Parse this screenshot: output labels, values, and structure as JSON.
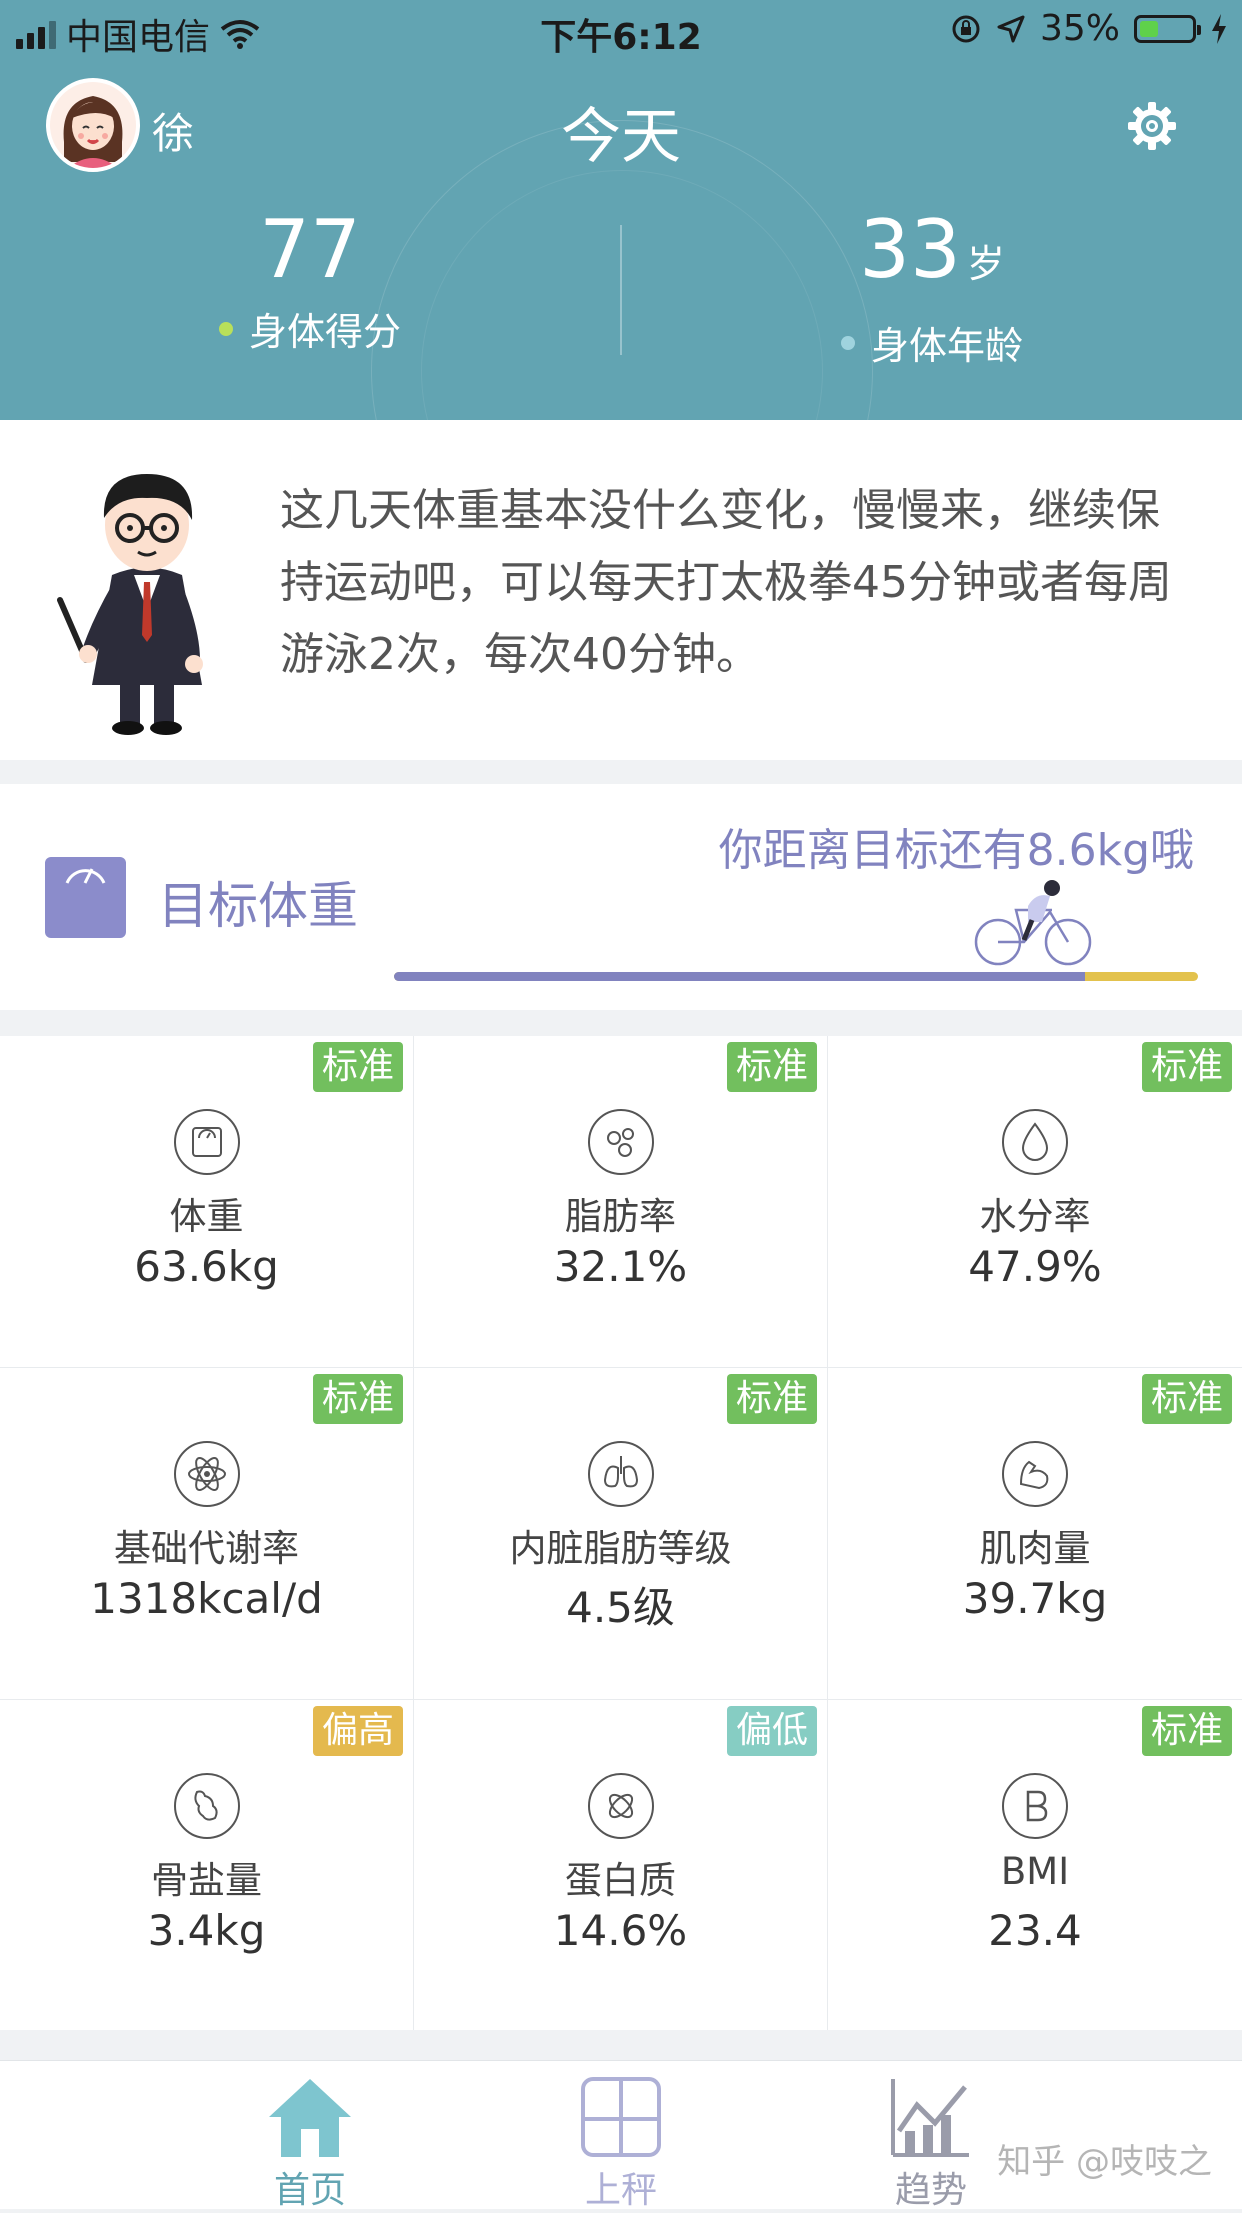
{
  "status_bar": {
    "carrier": "中国电信",
    "time": "下午6:12",
    "battery_percent": "35%",
    "battery_level": 0.35
  },
  "header": {
    "username": "徐",
    "title": "今天",
    "body_score": {
      "value": "77",
      "label": "身体得分",
      "dot_color": "#b9e05a"
    },
    "body_age": {
      "value": "33",
      "unit": "岁",
      "label": "身体年龄",
      "dot_color": "#9fd3de"
    }
  },
  "advice": {
    "text": "这几天体重基本没什么变化，慢慢来，继续保持运动吧，可以每天打太极拳45分钟或者每周游泳2次，每次40分钟。"
  },
  "target": {
    "label": "目标体重",
    "message": "你距离目标还有8.6kg哦",
    "progress": 0.86
  },
  "colors": {
    "header_bg": "#62a4b2",
    "accent_purple": "#8183bf",
    "badge_standard": "#72bf5e",
    "badge_high": "#e4b94e",
    "badge_low": "#86cdc3"
  },
  "metrics": [
    {
      "icon": "scale-icon",
      "name": "体重",
      "value": "63.6kg",
      "status": "标准",
      "status_color": "#72bf5e"
    },
    {
      "icon": "fat-molecule-icon",
      "name": "脂肪率",
      "value": "32.1%",
      "status": "标准",
      "status_color": "#72bf5e"
    },
    {
      "icon": "water-drop-icon",
      "name": "水分率",
      "value": "47.9%",
      "status": "标准",
      "status_color": "#72bf5e"
    },
    {
      "icon": "atom-icon",
      "name": "基础代谢率",
      "value": "1318kcal/d",
      "status": "标准",
      "status_color": "#72bf5e"
    },
    {
      "icon": "lungs-icon",
      "name": "内脏脂肪等级",
      "value": "4.5级",
      "status": "标准",
      "status_color": "#72bf5e"
    },
    {
      "icon": "muscle-icon",
      "name": "肌肉量",
      "value": "39.7kg",
      "status": "标准",
      "status_color": "#72bf5e"
    },
    {
      "icon": "bone-icon",
      "name": "骨盐量",
      "value": "3.4kg",
      "status": "偏高",
      "status_color": "#e4b94e"
    },
    {
      "icon": "protein-icon",
      "name": "蛋白质",
      "value": "14.6%",
      "status": "偏低",
      "status_color": "#86cdc3"
    },
    {
      "icon": "bmi-icon",
      "name": "BMI",
      "value": "23.4",
      "status": "标准",
      "status_color": "#72bf5e"
    }
  ],
  "tabs": [
    {
      "label": "首页",
      "icon": "home-icon",
      "active": true
    },
    {
      "label": "上秤",
      "icon": "scale-weigh-icon",
      "active": false
    },
    {
      "label": "趋势",
      "icon": "trend-chart-icon",
      "active": false
    }
  ],
  "watermark": "知乎 @吱吱之"
}
